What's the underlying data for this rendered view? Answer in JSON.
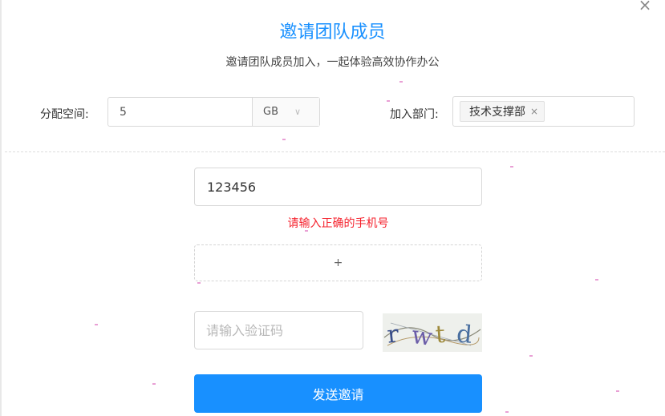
{
  "dialog": {
    "title": "邀请团队成员",
    "subtitle": "邀请团队成员加入，一起体验高效协作办公",
    "close_symbol": "×"
  },
  "space": {
    "label": "分配空间:",
    "value": "5",
    "unit": "GB",
    "arrow": "∨"
  },
  "department": {
    "label": "加入部门:",
    "tags": [
      {
        "label": "技术支撑部",
        "remove_symbol": "×"
      }
    ]
  },
  "phone": {
    "value": "123456",
    "error": "请输入正确的手机号"
  },
  "add_field": {
    "symbol": "+"
  },
  "verification": {
    "placeholder": "请输入验证码",
    "captcha_text": "rwtd"
  },
  "submit": {
    "label": "发送邀请"
  },
  "colors": {
    "primary": "#1890ff",
    "error": "#f5222d",
    "border": "#d9d9d9"
  },
  "icons": {
    "close": "close-icon",
    "dropdown": "chevron-down-icon",
    "tag_remove": "close-icon",
    "add": "plus-icon"
  }
}
